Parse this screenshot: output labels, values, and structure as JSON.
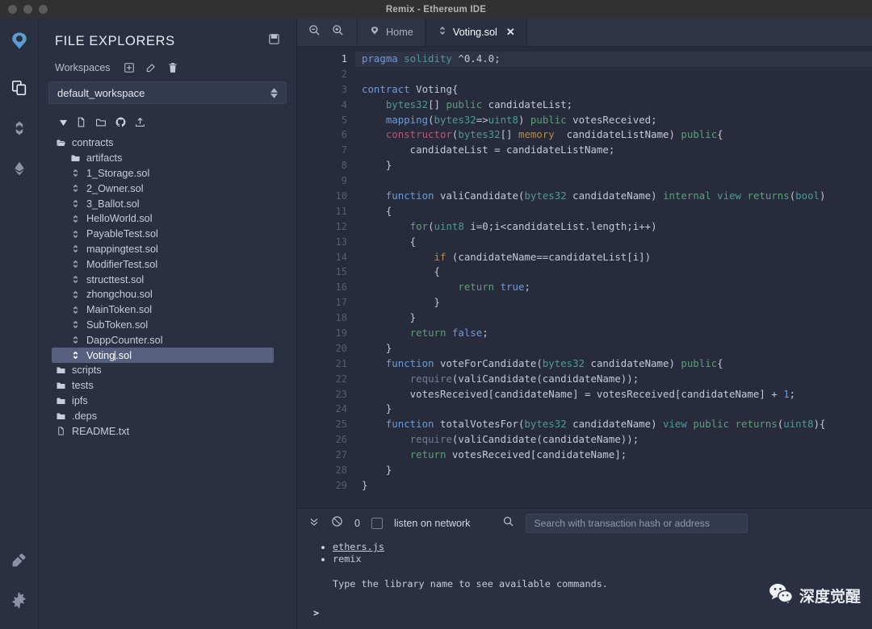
{
  "window": {
    "title": "Remix - Ethereum IDE",
    "traffic_lights": [
      "close",
      "minimize",
      "zoom"
    ]
  },
  "rail": {
    "items": [
      {
        "name": "remix-logo-icon",
        "label": "Remix",
        "active": false
      },
      {
        "name": "file-explorers-icon",
        "label": "File explorers",
        "active": true
      },
      {
        "name": "solidity-compiler-icon",
        "label": "Solidity compiler",
        "active": false
      },
      {
        "name": "deploy-run-icon",
        "label": "Deploy & run transactions",
        "active": false
      }
    ],
    "bottom_items": [
      {
        "name": "plugin-manager-icon",
        "label": "Plugin manager"
      },
      {
        "name": "settings-icon",
        "label": "Settings"
      }
    ]
  },
  "explorer": {
    "title": "FILE EXPLORERS",
    "panel_icon": "save-icon",
    "workspaces_label": "Workspaces",
    "workspace_actions": [
      {
        "name": "create-workspace-icon",
        "label": "Create"
      },
      {
        "name": "rename-workspace-icon",
        "label": "Rename"
      },
      {
        "name": "delete-workspace-icon",
        "label": "Delete"
      }
    ],
    "selected_workspace": "default_workspace",
    "tree_toolbar": [
      {
        "name": "new-file-icon",
        "label": "New File"
      },
      {
        "name": "new-folder-icon",
        "label": "New Folder"
      },
      {
        "name": "github-icon",
        "label": "Publish to Gist"
      },
      {
        "name": "upload-file-icon",
        "label": "Upload File"
      }
    ],
    "tree": [
      {
        "name": "contracts",
        "type": "folder-open",
        "depth": 1,
        "selected": false
      },
      {
        "name": "artifacts",
        "type": "folder",
        "depth": 2,
        "selected": false
      },
      {
        "name": "1_Storage.sol",
        "type": "sol",
        "depth": 2,
        "selected": false
      },
      {
        "name": "2_Owner.sol",
        "type": "sol",
        "depth": 2,
        "selected": false
      },
      {
        "name": "3_Ballot.sol",
        "type": "sol",
        "depth": 2,
        "selected": false
      },
      {
        "name": "HelloWorld.sol",
        "type": "sol",
        "depth": 2,
        "selected": false
      },
      {
        "name": "PayableTest.sol",
        "type": "sol",
        "depth": 2,
        "selected": false
      },
      {
        "name": "mappingtest.sol",
        "type": "sol",
        "depth": 2,
        "selected": false
      },
      {
        "name": "ModifierTest.sol",
        "type": "sol",
        "depth": 2,
        "selected": false
      },
      {
        "name": "structtest.sol",
        "type": "sol",
        "depth": 2,
        "selected": false
      },
      {
        "name": "zhongchou.sol",
        "type": "sol",
        "depth": 2,
        "selected": false
      },
      {
        "name": "MainToken.sol",
        "type": "sol",
        "depth": 2,
        "selected": false
      },
      {
        "name": "SubToken.sol",
        "type": "sol",
        "depth": 2,
        "selected": false
      },
      {
        "name": "DappCounter.sol",
        "type": "sol",
        "depth": 2,
        "selected": false
      },
      {
        "name": "Voting.sol",
        "type": "sol",
        "depth": 2,
        "selected": true,
        "editing": true,
        "cursor_after": "Voting"
      },
      {
        "name": "scripts",
        "type": "folder",
        "depth": 1,
        "selected": false
      },
      {
        "name": "tests",
        "type": "folder",
        "depth": 1,
        "selected": false
      },
      {
        "name": "ipfs",
        "type": "folder",
        "depth": 1,
        "selected": false
      },
      {
        "name": ".deps",
        "type": "folder",
        "depth": 1,
        "selected": false
      },
      {
        "name": "README.txt",
        "type": "file",
        "depth": 1,
        "selected": false
      }
    ]
  },
  "editor": {
    "zoom_out_label": "Zoom out",
    "zoom_in_label": "Zoom in",
    "tabs": [
      {
        "label": "Home",
        "icon": "remix-home-icon",
        "active": false,
        "closable": false
      },
      {
        "label": "Voting.sol",
        "icon": "solidity-icon",
        "active": true,
        "closable": true,
        "close_label": "✕"
      }
    ],
    "active_line": 1,
    "total_lines": 29,
    "lines": [
      {
        "n": 1,
        "tokens": [
          {
            "t": "pragma ",
            "c": "k"
          },
          {
            "t": "solidity ",
            "c": "kw"
          },
          {
            "t": "^0.4.0;",
            "c": ""
          }
        ]
      },
      {
        "n": 2,
        "tokens": []
      },
      {
        "n": 3,
        "tokens": [
          {
            "t": "contract ",
            "c": "k"
          },
          {
            "t": "Voting{",
            "c": ""
          }
        ]
      },
      {
        "n": 4,
        "tokens": [
          {
            "t": "    ",
            "c": ""
          },
          {
            "t": "bytes32",
            "c": "kw"
          },
          {
            "t": "[] ",
            "c": ""
          },
          {
            "t": "public",
            "c": "g"
          },
          {
            "t": " candidateList;",
            "c": ""
          }
        ]
      },
      {
        "n": 5,
        "tokens": [
          {
            "t": "    ",
            "c": ""
          },
          {
            "t": "mapping",
            "c": "k"
          },
          {
            "t": "(",
            "c": ""
          },
          {
            "t": "bytes32",
            "c": "kw"
          },
          {
            "t": "=>",
            "c": ""
          },
          {
            "t": "uint8",
            "c": "kw"
          },
          {
            "t": ") ",
            "c": ""
          },
          {
            "t": "public",
            "c": "g"
          },
          {
            "t": " votesReceived;",
            "c": ""
          }
        ]
      },
      {
        "n": 6,
        "tokens": [
          {
            "t": "    ",
            "c": ""
          },
          {
            "t": "constructor",
            "c": "p"
          },
          {
            "t": "(",
            "c": ""
          },
          {
            "t": "bytes32",
            "c": "kw"
          },
          {
            "t": "[] ",
            "c": ""
          },
          {
            "t": "memory",
            "c": "o"
          },
          {
            "t": "  candidateListName) ",
            "c": ""
          },
          {
            "t": "public",
            "c": "g"
          },
          {
            "t": "{",
            "c": ""
          }
        ]
      },
      {
        "n": 7,
        "tokens": [
          {
            "t": "        candidateList = candidateListName;",
            "c": ""
          }
        ]
      },
      {
        "n": 8,
        "tokens": [
          {
            "t": "    }",
            "c": ""
          }
        ]
      },
      {
        "n": 9,
        "tokens": []
      },
      {
        "n": 10,
        "tokens": [
          {
            "t": "    ",
            "c": ""
          },
          {
            "t": "function",
            "c": "k"
          },
          {
            "t": " valiCandidate(",
            "c": ""
          },
          {
            "t": "bytes32",
            "c": "kw"
          },
          {
            "t": " candidateName) ",
            "c": ""
          },
          {
            "t": "internal",
            "c": "g"
          },
          {
            "t": " ",
            "c": ""
          },
          {
            "t": "view",
            "c": "kw"
          },
          {
            "t": " ",
            "c": ""
          },
          {
            "t": "returns",
            "c": "g"
          },
          {
            "t": "(",
            "c": ""
          },
          {
            "t": "bool",
            "c": "kw"
          },
          {
            "t": ")",
            "c": ""
          }
        ]
      },
      {
        "n": 11,
        "tokens": [
          {
            "t": "    {",
            "c": ""
          }
        ]
      },
      {
        "n": 12,
        "tokens": [
          {
            "t": "        ",
            "c": ""
          },
          {
            "t": "for",
            "c": "g"
          },
          {
            "t": "(",
            "c": ""
          },
          {
            "t": "uint8",
            "c": "kw"
          },
          {
            "t": " i=0;i<candidateList.length;i++)",
            "c": ""
          }
        ]
      },
      {
        "n": 13,
        "tokens": [
          {
            "t": "        {",
            "c": ""
          }
        ]
      },
      {
        "n": 14,
        "tokens": [
          {
            "t": "            ",
            "c": ""
          },
          {
            "t": "if",
            "c": "o"
          },
          {
            "t": " (candidateName==candidateList[i])",
            "c": ""
          }
        ]
      },
      {
        "n": 15,
        "tokens": [
          {
            "t": "            {",
            "c": ""
          }
        ]
      },
      {
        "n": 16,
        "tokens": [
          {
            "t": "                ",
            "c": ""
          },
          {
            "t": "return",
            "c": "g"
          },
          {
            "t": " ",
            "c": ""
          },
          {
            "t": "true",
            "c": "k"
          },
          {
            "t": ";",
            "c": ""
          }
        ]
      },
      {
        "n": 17,
        "tokens": [
          {
            "t": "            }",
            "c": ""
          }
        ]
      },
      {
        "n": 18,
        "tokens": [
          {
            "t": "        }",
            "c": ""
          }
        ]
      },
      {
        "n": 19,
        "tokens": [
          {
            "t": "        ",
            "c": ""
          },
          {
            "t": "return",
            "c": "g"
          },
          {
            "t": " ",
            "c": ""
          },
          {
            "t": "false",
            "c": "k"
          },
          {
            "t": ";",
            "c": ""
          }
        ]
      },
      {
        "n": 20,
        "tokens": [
          {
            "t": "    }",
            "c": ""
          }
        ]
      },
      {
        "n": 21,
        "tokens": [
          {
            "t": "    ",
            "c": ""
          },
          {
            "t": "function",
            "c": "k"
          },
          {
            "t": " voteForCandidate(",
            "c": ""
          },
          {
            "t": "bytes32",
            "c": "kw"
          },
          {
            "t": " candidateName) ",
            "c": ""
          },
          {
            "t": "public",
            "c": "g"
          },
          {
            "t": "{",
            "c": ""
          }
        ]
      },
      {
        "n": 22,
        "tokens": [
          {
            "t": "        ",
            "c": ""
          },
          {
            "t": "require",
            "c": "m"
          },
          {
            "t": "(valiCandidate(candidateName));",
            "c": ""
          }
        ]
      },
      {
        "n": 23,
        "tokens": [
          {
            "t": "        votesReceived[candidateName] = votesReceived[candidateName] + ",
            "c": ""
          },
          {
            "t": "1",
            "c": "n"
          },
          {
            "t": ";",
            "c": ""
          }
        ]
      },
      {
        "n": 24,
        "tokens": [
          {
            "t": "    }",
            "c": ""
          }
        ]
      },
      {
        "n": 25,
        "tokens": [
          {
            "t": "    ",
            "c": ""
          },
          {
            "t": "function",
            "c": "k"
          },
          {
            "t": " totalVotesFor(",
            "c": ""
          },
          {
            "t": "bytes32",
            "c": "kw"
          },
          {
            "t": " candidateName) ",
            "c": ""
          },
          {
            "t": "view",
            "c": "kw"
          },
          {
            "t": " ",
            "c": ""
          },
          {
            "t": "public",
            "c": "g"
          },
          {
            "t": " ",
            "c": ""
          },
          {
            "t": "returns",
            "c": "g"
          },
          {
            "t": "(",
            "c": ""
          },
          {
            "t": "uint8",
            "c": "kw"
          },
          {
            "t": "){",
            "c": ""
          }
        ]
      },
      {
        "n": 26,
        "tokens": [
          {
            "t": "        ",
            "c": ""
          },
          {
            "t": "require",
            "c": "m"
          },
          {
            "t": "(valiCandidate(candidateName));",
            "c": ""
          }
        ]
      },
      {
        "n": 27,
        "tokens": [
          {
            "t": "        ",
            "c": ""
          },
          {
            "t": "return",
            "c": "g"
          },
          {
            "t": " votesReceived[candidateName];",
            "c": ""
          }
        ]
      },
      {
        "n": 28,
        "tokens": [
          {
            "t": "    }",
            "c": ""
          }
        ]
      },
      {
        "n": 29,
        "tokens": [
          {
            "t": "}",
            "c": ""
          }
        ]
      }
    ]
  },
  "terminal": {
    "collapse_icon": "double-chevron-down-icon",
    "clear_icon": "ban-icon",
    "pending_count": "0",
    "listen_checkbox_label": "listen on network",
    "listen_checked": false,
    "search_icon": "search-icon",
    "search_placeholder": "Search with transaction hash or address",
    "libraries": [
      "ethers.js",
      "remix"
    ],
    "note": "Type the library name to see available commands.",
    "prompt": ">"
  },
  "watermark": {
    "icon": "wechat-icon",
    "text": "深度觉醒"
  }
}
